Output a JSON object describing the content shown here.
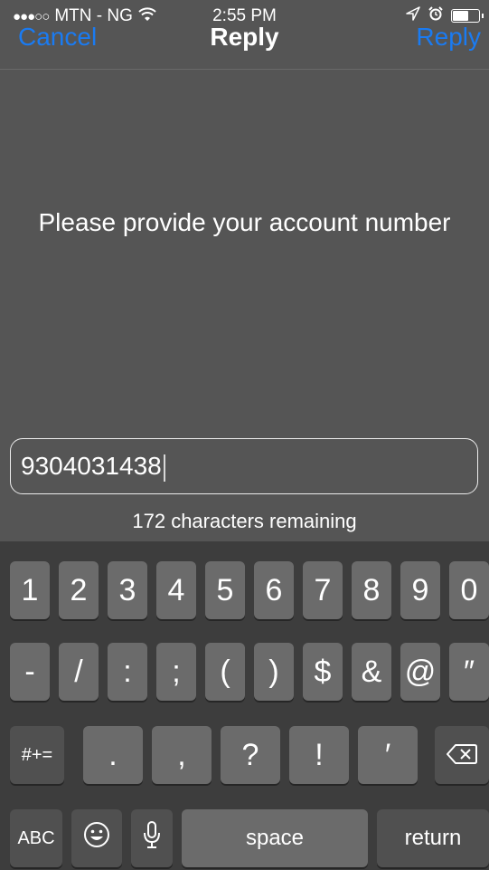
{
  "status_bar": {
    "signal": "●●●○○",
    "carrier": "MTN - NG",
    "wifi_icon": "wifi-icon",
    "time": "2:55 PM",
    "location_icon": "location-arrow-icon",
    "alarm_icon": "alarm-clock-icon",
    "battery_icon": "battery-icon"
  },
  "nav": {
    "cancel_label": "Cancel",
    "title": "Reply",
    "reply_label": "Reply",
    "accent_color": "#1a7bf2"
  },
  "message": {
    "prompt": "Please provide your account number"
  },
  "input": {
    "value": "9304031438",
    "remaining_text": "172 characters remaining"
  },
  "keyboard": {
    "row1": [
      "1",
      "2",
      "3",
      "4",
      "5",
      "6",
      "7",
      "8",
      "9",
      "0"
    ],
    "row2": [
      "-",
      "/",
      ":",
      ";",
      "(",
      ")",
      "$",
      "&",
      "@",
      "″"
    ],
    "row3": {
      "mode_key": "#+=",
      "keys": [
        ".",
        ",",
        "?",
        "!",
        "′"
      ],
      "delete_icon": "backspace-icon"
    },
    "row4": {
      "abc_key": "ABC",
      "emoji_icon": "emoji-smiley-icon",
      "mic_icon": "microphone-icon",
      "space_label": "space",
      "return_label": "return"
    }
  }
}
